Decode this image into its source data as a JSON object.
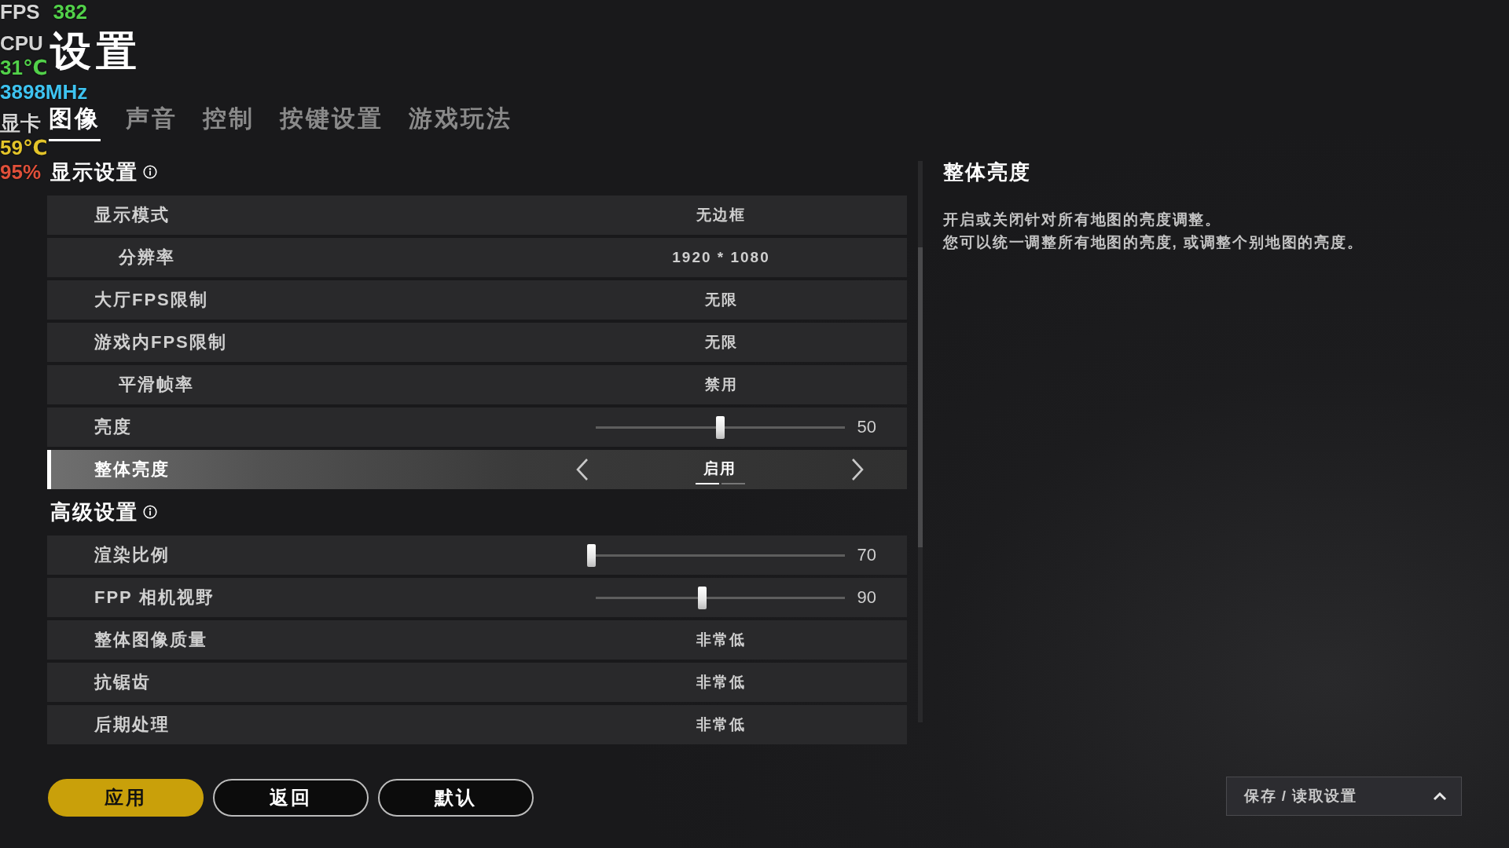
{
  "hardware_monitor": {
    "groups": [
      {
        "lines": [
          {
            "items": [
              {
                "text": "FPS",
                "color": "#d4d4d4"
              },
              {
                "text": "382",
                "color": "#52d14a"
              }
            ]
          }
        ]
      },
      {
        "lines": [
          {
            "items": [
              {
                "text": "CPU",
                "color": "#d4d4d4"
              }
            ]
          },
          {
            "items": [
              {
                "text": "31℃",
                "color": "#52d14a"
              }
            ]
          },
          {
            "items": [
              {
                "text": "3898MHz",
                "color": "#3ec3f0"
              }
            ]
          }
        ]
      },
      {
        "lines": [
          {
            "items": [
              {
                "text": "显卡",
                "color": "#d4d4d4"
              }
            ]
          },
          {
            "items": [
              {
                "text": "59℃",
                "color": "#e3c42a"
              }
            ]
          },
          {
            "items": [
              {
                "text": "95%",
                "color": "#e0503a"
              }
            ]
          }
        ]
      }
    ]
  },
  "title": "设置",
  "tabs": [
    {
      "label": "图像",
      "selected": true
    },
    {
      "label": "声音",
      "selected": false
    },
    {
      "label": "控制",
      "selected": false
    },
    {
      "label": "按键设置",
      "selected": false
    },
    {
      "label": "游戏玩法",
      "selected": false
    }
  ],
  "sections": [
    {
      "heading": "显示设置",
      "rows": [
        {
          "label": "显示模式",
          "kind": "text",
          "value": "无边框",
          "selected": false,
          "children": [
            {
              "label": "分辨率",
              "kind": "text",
              "value": "1920 * 1080",
              "selected": false
            }
          ]
        },
        {
          "label": "大厅FPS限制",
          "kind": "text",
          "value": "无限",
          "selected": false
        },
        {
          "label": "游戏内FPS限制",
          "kind": "text",
          "value": "无限",
          "selected": false,
          "children": [
            {
              "label": "平滑帧率",
              "kind": "text",
              "value": "禁用",
              "selected": false
            }
          ]
        },
        {
          "label": "亮度",
          "kind": "slider",
          "level": 0.5,
          "value": "50",
          "selected": false
        },
        {
          "label": "整体亮度",
          "kind": "option",
          "value": "启用",
          "selected": true,
          "options": [
            {
              "selected": true
            },
            {
              "selected": false
            }
          ]
        }
      ]
    },
    {
      "heading": "高级设置",
      "rows": [
        {
          "label": "渲染比例",
          "kind": "slider",
          "level": 0,
          "value": "70",
          "selected": false
        },
        {
          "label": "FPP 相机视野",
          "kind": "slider",
          "level": 0.43,
          "value": "90",
          "selected": false
        },
        {
          "label": "整体图像质量",
          "kind": "text",
          "value": "非常低",
          "selected": false
        },
        {
          "label": "抗锯齿",
          "kind": "text",
          "value": "非常低",
          "selected": false
        },
        {
          "label": "后期处理",
          "kind": "text",
          "value": "非常低",
          "selected": false
        }
      ]
    }
  ],
  "detail_panel": {
    "title": "整体亮度",
    "lines": [
      "开启或关闭针对所有地图的亮度调整。",
      "您可以统一调整所有地图的亮度, 或调整个别地图的亮度。"
    ]
  },
  "buttons": [
    {
      "label": "应用",
      "kind": "primary"
    },
    {
      "label": "返回",
      "kind": "outline"
    },
    {
      "label": "默认",
      "kind": "outline"
    }
  ],
  "preset_menu": {
    "label": "保存 / 读取设置"
  }
}
